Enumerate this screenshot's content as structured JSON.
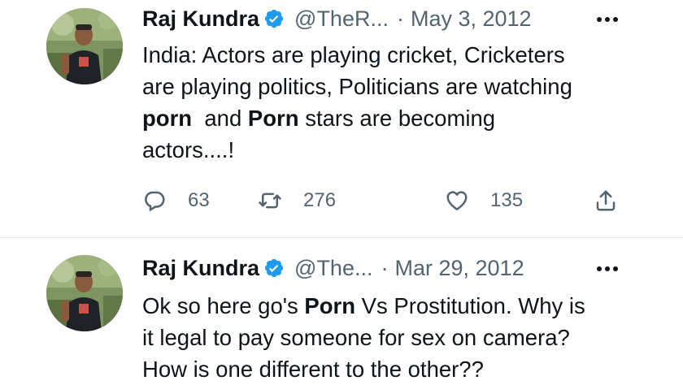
{
  "tweets": [
    {
      "author": {
        "name": "Raj Kundra",
        "handle": "@TheR...",
        "avatar_icon": "profile-photo"
      },
      "date": "May 3, 2012",
      "separator": "·",
      "body": {
        "line1": "India: Actors are playing cricket,  Cricketers",
        "line2": "are playing politics,  Politicians are watching",
        "line3_bold1": "porn",
        "line3_mid": "  and ",
        "line3_bold2": "Porn",
        "line3_end": " stars are becoming",
        "line4": "actors....!"
      },
      "stats": {
        "replies": "63",
        "retweets": "276",
        "likes": "135"
      }
    },
    {
      "author": {
        "name": "Raj Kundra",
        "handle": "@The...",
        "avatar_icon": "profile-photo"
      },
      "date": "Mar 29, 2012",
      "separator": "·",
      "body": {
        "line1_start": "Ok so here go's ",
        "line1_bold": "Porn",
        "line1_end": " Vs Prostitution. Why is",
        "line2": "it legal to pay someone for sex on camera?",
        "line3": "How is one different to the other??"
      }
    }
  ],
  "icons": {
    "verified": "verified-badge-icon",
    "more": "more-icon",
    "reply": "reply-icon",
    "retweet": "retweet-icon",
    "like": "heart-icon",
    "share": "share-icon"
  },
  "colors": {
    "verified_blue": "#1d9bf0",
    "text": "#0f1419",
    "secondary": "#536471",
    "divider": "#e6e9eb"
  }
}
